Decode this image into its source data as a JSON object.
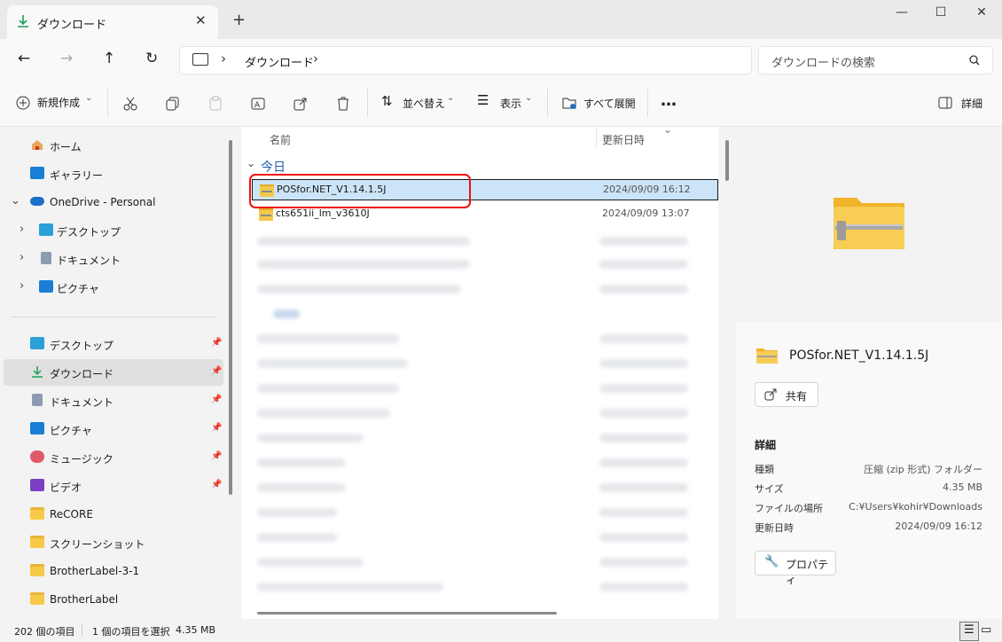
{
  "window": {
    "tab_title": "ダウンロード",
    "close_tab": "✕",
    "new_tab": "+",
    "minimize": "—",
    "maximize": "☐",
    "close": "✕"
  },
  "nav": {
    "back": "←",
    "forward": "→",
    "up": "↑",
    "refresh": "↻",
    "breadcrumb": [
      "ダウンロード"
    ],
    "search_placeholder": "ダウンロードの検索"
  },
  "toolbar": {
    "new_label": "新規作成",
    "sort_label": "並べ替え",
    "view_label": "表示",
    "expand_all_label": "すべて展開",
    "more_label": "…",
    "details_label": "詳細"
  },
  "sidebar": {
    "items": [
      {
        "label": "ホーム"
      },
      {
        "label": "ギャラリー"
      },
      {
        "label": "OneDrive - Personal"
      },
      {
        "label": "デスクトップ"
      },
      {
        "label": "ドキュメント"
      },
      {
        "label": "ピクチャ"
      },
      {
        "label": "デスクトップ"
      },
      {
        "label": "ダウンロード"
      },
      {
        "label": "ドキュメント"
      },
      {
        "label": "ピクチャ"
      },
      {
        "label": "ミュージック"
      },
      {
        "label": "ビデオ"
      },
      {
        "label": "ReCORE"
      },
      {
        "label": "スクリーンショット"
      },
      {
        "label": "BrotherLabel-3-1"
      },
      {
        "label": "BrotherLabel"
      }
    ]
  },
  "filelist": {
    "col_name": "名前",
    "col_date": "更新日時",
    "group_today": "今日",
    "rows": [
      {
        "name": "POSfor.NET_V1.14.1.5J",
        "date": "2024/09/09 16:12"
      },
      {
        "name": "cts651ii_lm_v3610J",
        "date": "2024/09/09 13:07"
      }
    ]
  },
  "details": {
    "file_name": "POSfor.NET_V1.14.1.5J",
    "share_label": "共有",
    "section_title": "詳細",
    "fields": [
      {
        "key": "種類",
        "value": "圧縮 (zip 形式) フォルダー"
      },
      {
        "key": "サイズ",
        "value": "4.35 MB"
      },
      {
        "key": "ファイルの場所",
        "value": "C:¥Users¥kohir¥Downloads"
      },
      {
        "key": "更新日時",
        "value": "2024/09/09 16:12"
      }
    ],
    "properties_label": "プロパティ"
  },
  "status": {
    "item_count": "202 個の項目",
    "selected": "1 個の項目を選択",
    "selected_size": "4.35 MB"
  },
  "colors": {
    "selection": "#cce4f7",
    "highlight_box": "#e11111",
    "folder": "#f7c948"
  }
}
